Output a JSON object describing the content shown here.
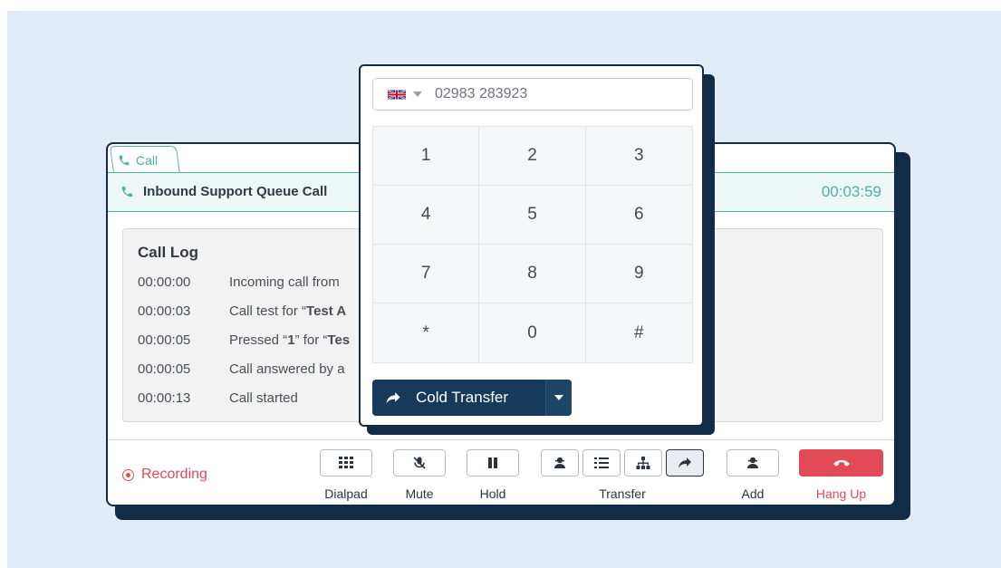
{
  "call_window": {
    "tab_label": "Call",
    "title": "Inbound Support Queue Call",
    "timer": "00:03:59"
  },
  "call_log": {
    "title": "Call Log",
    "entries": [
      {
        "time": "00:00:00",
        "text": "Incoming call from"
      },
      {
        "time": "00:00:03",
        "text_pre": "Call test for “",
        "text_bold": "Test A"
      },
      {
        "time": "00:00:05",
        "text_pre": "Pressed “",
        "text_bold": "1",
        "text_mid": "” for “",
        "text_bold2": "Tes"
      },
      {
        "time": "00:00:05",
        "text": "Call answered by a"
      },
      {
        "time": "00:00:13",
        "text": "Call started"
      }
    ]
  },
  "footer": {
    "recording_label": "Recording",
    "dialpad_label": "Dialpad",
    "mute_label": "Mute",
    "hold_label": "Hold",
    "transfer_label": "Transfer",
    "add_label": "Add",
    "hangup_label": "Hang Up"
  },
  "dialpad": {
    "phone_placeholder": "02983 283923",
    "country_flag": "uk-flag-icon",
    "keys": [
      "1",
      "2",
      "3",
      "4",
      "5",
      "6",
      "7",
      "8",
      "9",
      "*",
      "0",
      "#"
    ],
    "transfer_button": "Cold Transfer"
  },
  "colors": {
    "teal": "#4fb0a7",
    "navy": "#122c48",
    "danger": "#e24a57",
    "background": "#e2ecf9"
  }
}
